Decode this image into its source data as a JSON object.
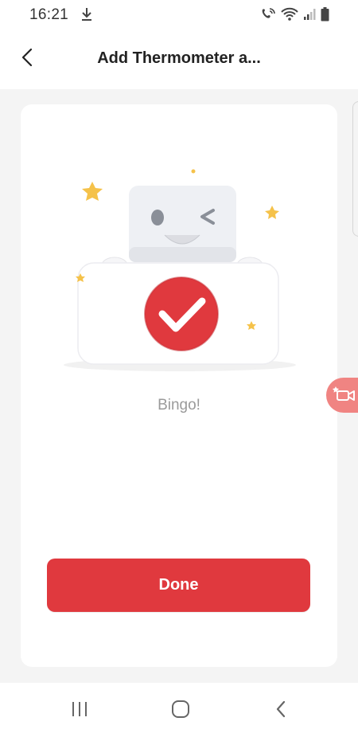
{
  "status_bar": {
    "time": "16:21",
    "icons": [
      "download-icon",
      "wifi-calling-icon",
      "wifi-icon",
      "signal-icon",
      "battery-icon"
    ]
  },
  "header": {
    "title": "Add Thermometer a...",
    "back_icon": "chevron-left-icon"
  },
  "main": {
    "illustration": "robot-success-illustration",
    "message": "Bingo!",
    "done_label": "Done"
  },
  "floating": {
    "icon": "video-camera-icon"
  },
  "nav_bar": {
    "icons": [
      "recent-apps-icon",
      "home-icon",
      "back-icon"
    ]
  },
  "colors": {
    "accent": "#e0393e",
    "floating_button": "#f08482",
    "background": "#f4f4f4",
    "message_text": "#9a9a9a",
    "star": "#f5c24a"
  }
}
